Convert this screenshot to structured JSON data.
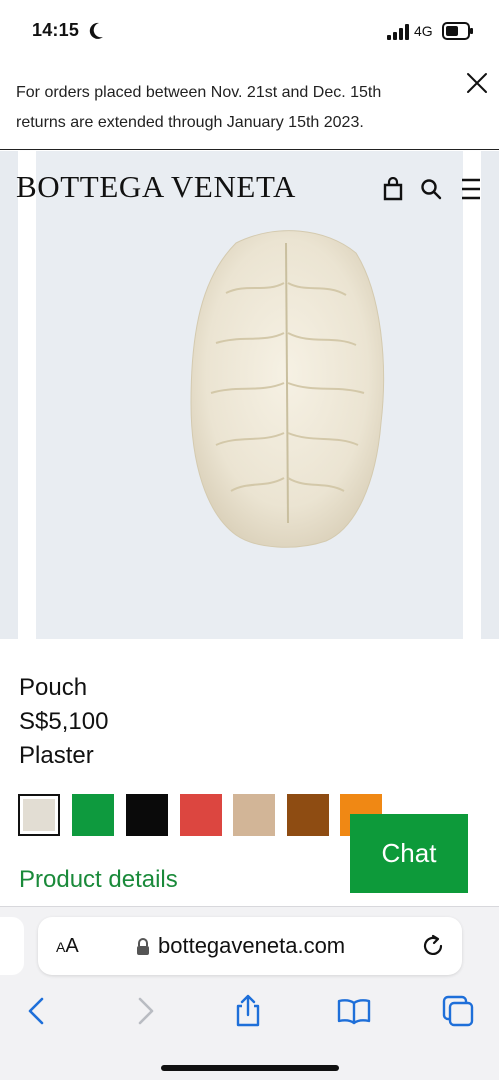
{
  "status_bar": {
    "time": "14:15",
    "network": "4G",
    "icons": [
      "moon-icon",
      "signal-icon",
      "battery-icon"
    ]
  },
  "promo": {
    "line1": "For orders placed between Nov. 21st and Dec. 15th",
    "line2": "returns are extended through January 15th 2023.",
    "close_icon": "close-icon"
  },
  "header": {
    "brand": "BOTTEGA VENETA",
    "icons": [
      "bag-icon",
      "search-icon",
      "menu-icon"
    ]
  },
  "product": {
    "name": "Pouch",
    "price": "S$5,100",
    "color": "Plaster",
    "swatches": [
      {
        "name": "plaster",
        "color": "#e2ddd3",
        "selected": true
      },
      {
        "name": "green",
        "color": "#0e9a3e",
        "selected": false
      },
      {
        "name": "black",
        "color": "#0a0a0a",
        "selected": false
      },
      {
        "name": "red",
        "color": "#dc4640",
        "selected": false
      },
      {
        "name": "beige",
        "color": "#d2b597",
        "selected": false
      },
      {
        "name": "brown",
        "color": "#8e4c12",
        "selected": false
      },
      {
        "name": "orange",
        "color": "#f08814",
        "selected": false
      }
    ],
    "details_link": "Product details"
  },
  "chat": {
    "label": "Chat",
    "color": "#0d9a3a"
  },
  "browser": {
    "text_size_label_small": "A",
    "text_size_label_large": "A",
    "url": "bottegaveneta.com",
    "icons": [
      "lock-icon",
      "reload-icon",
      "back-icon",
      "forward-icon",
      "share-icon",
      "bookmarks-icon",
      "tabs-icon"
    ]
  },
  "colors": {
    "accent_green": "#1a8a3a",
    "link_blue": "#1e6fd9"
  }
}
